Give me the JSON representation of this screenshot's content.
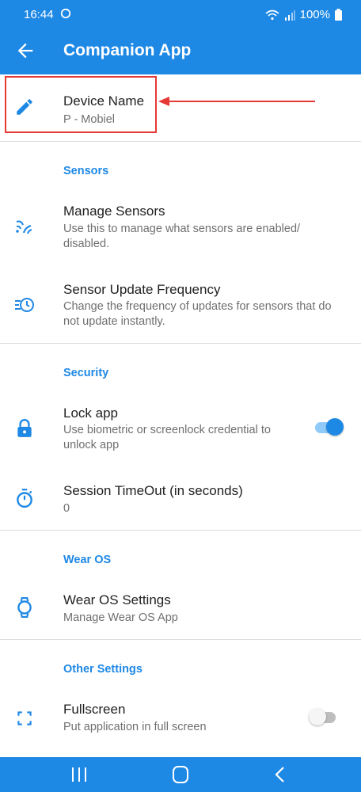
{
  "status_bar": {
    "time": "16:44",
    "battery": "100%",
    "icons": [
      "sync-icon",
      "wifi-icon",
      "signal-icon",
      "battery-icon"
    ]
  },
  "app_bar": {
    "title": "Companion App",
    "back_icon": "arrow-back-icon"
  },
  "colors": {
    "primary": "#1e88e5",
    "highlight_border": "#e53935",
    "toggle_on_thumb": "#1e88e5",
    "toggle_on_track": "#90caf9",
    "toggle_off_thumb": "#f5f5f5",
    "toggle_off_track": "#bdbdbd"
  },
  "device": {
    "title": "Device Name",
    "value": "P      - Mobiel",
    "icon": "pencil-icon"
  },
  "sections": {
    "sensors": "Sensors",
    "security": "Security",
    "wear_os": "Wear OS",
    "other": "Other Settings"
  },
  "settings": {
    "manage_sensors": {
      "title": "Manage Sensors",
      "subtitle": "Use this to manage what sensors are enabled/ disabled.",
      "icon": "sensors-icon"
    },
    "sensor_update_frequency": {
      "title": "Sensor Update Frequency",
      "subtitle": "Change the frequency of updates for sensors that do not update instantly.",
      "icon": "update-frequency-icon"
    },
    "lock_app": {
      "title": "Lock app",
      "subtitle": "Use biometric or screenlock credential to unlock app",
      "icon": "lock-icon",
      "enabled": true
    },
    "session_timeout": {
      "title": "Session TimeOut (in seconds)",
      "value": "0",
      "icon": "timer-icon"
    },
    "wear_os_settings": {
      "title": "Wear OS Settings",
      "subtitle": "Manage Wear OS App",
      "icon": "watch-icon"
    },
    "fullscreen": {
      "title": "Fullscreen",
      "subtitle": "Put application in full screen",
      "icon": "fullscreen-icon",
      "enabled": false
    }
  },
  "nav_bar": {
    "icons": [
      "recent-apps-icon",
      "home-icon",
      "back-icon"
    ]
  }
}
